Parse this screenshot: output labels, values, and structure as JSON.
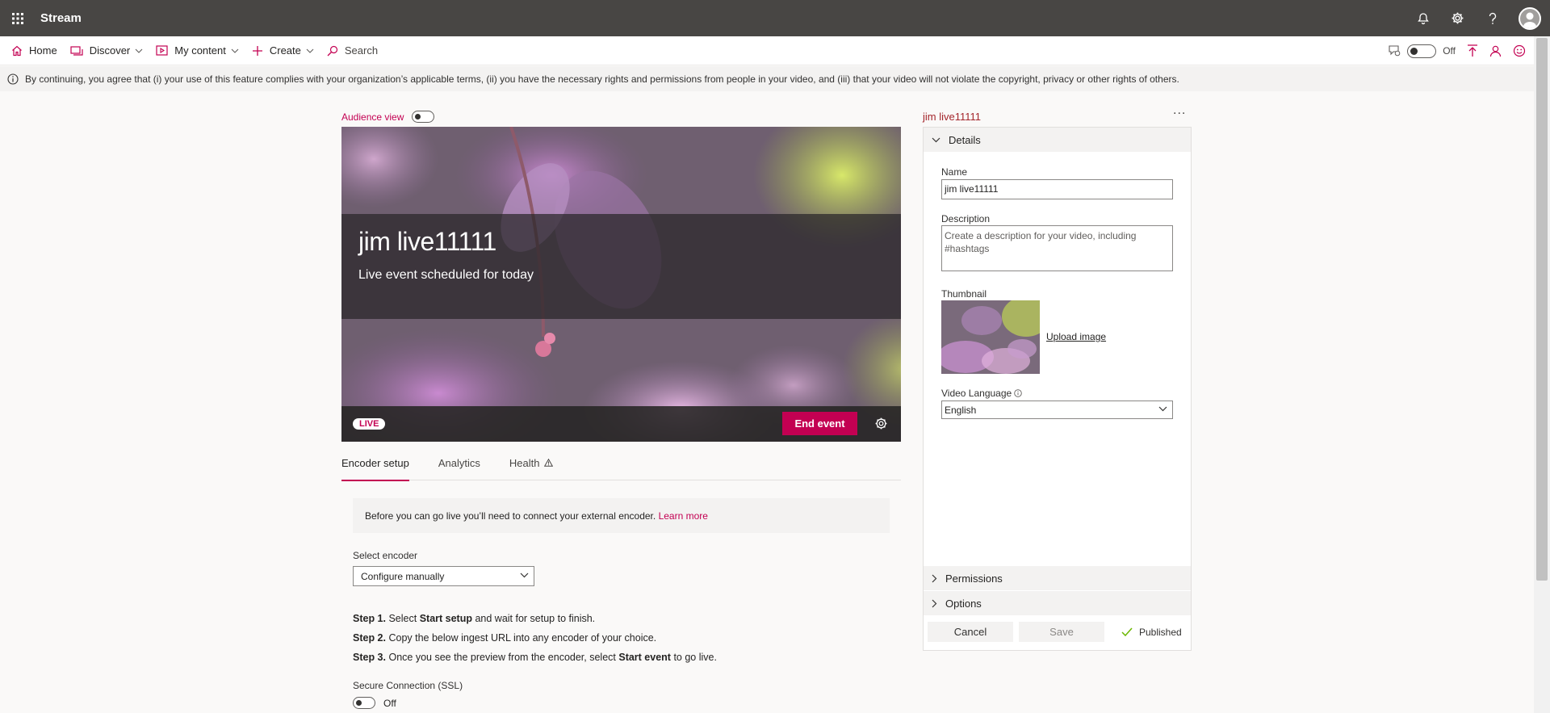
{
  "app": {
    "title": "Stream"
  },
  "nav": {
    "home": "Home",
    "discover": "Discover",
    "my_content": "My content",
    "create": "Create",
    "search_placeholder": "Search",
    "toggle_state": "Off"
  },
  "notice": {
    "text": "By continuing, you agree that (i) your use of this feature complies with your organization’s applicable terms, (ii) you have the necessary rights and permissions from people in your video, and (iii) that your video will not violate the copyright, privacy or other rights of others."
  },
  "player": {
    "audience_view_label": "Audience view",
    "event_title": "jim live11111",
    "event_subtitle": "Live event scheduled for today",
    "live_badge": "LIVE",
    "end_event_label": "End event"
  },
  "tabs": [
    {
      "label": "Encoder setup"
    },
    {
      "label": "Analytics"
    },
    {
      "label": "Health"
    }
  ],
  "encoder": {
    "info_text": "Before you can go live you’ll need to connect your external encoder.",
    "learn_more": "Learn more",
    "select_label": "Select encoder",
    "select_value": "Configure manually",
    "step1_num": "Step 1.",
    "step1_a": " Select ",
    "step1_b": "Start setup",
    "step1_c": " and wait for setup to finish.",
    "step2_num": "Step 2.",
    "step2_text": " Copy the below ingest URL into any encoder of your choice.",
    "step3_num": "Step 3.",
    "step3_a": " Once you see the preview from the encoder, select ",
    "step3_b": "Start event",
    "step3_c": " to go live.",
    "ssl_label": "Secure Connection (SSL)",
    "ssl_state": "Off"
  },
  "panel": {
    "title": "jim live11111",
    "more": "...",
    "details_label": "Details",
    "name_label": "Name",
    "name_value": "jim live11111",
    "description_label": "Description",
    "description_placeholder": "Create a description for your video, including #hashtags",
    "thumbnail_label": "Thumbnail",
    "upload_image": "Upload image",
    "video_language_label": "Video Language",
    "video_language_value": "English",
    "permissions_label": "Permissions",
    "options_label": "Options",
    "cancel_label": "Cancel",
    "save_label": "Save",
    "published_label": "Published"
  },
  "colors": {
    "accent": "#c30052",
    "topbar": "#484644"
  }
}
